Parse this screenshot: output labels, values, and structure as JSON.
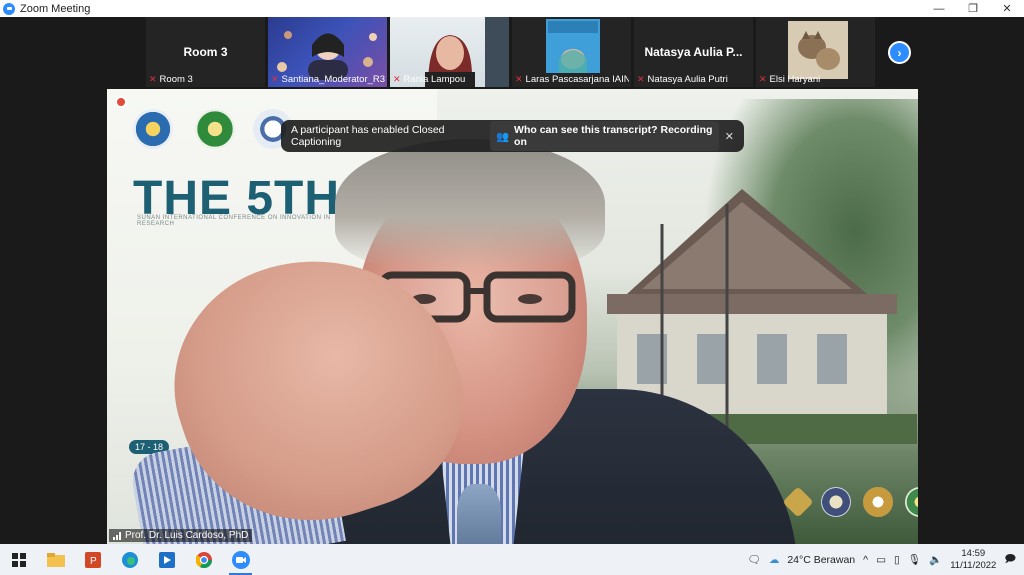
{
  "window": {
    "title": "Zoom Meeting",
    "minimize": "—",
    "restore": "❐",
    "close": "✕"
  },
  "strip": {
    "tiles": [
      {
        "big_name": "Room 3",
        "caption": "Room 3",
        "type": "name"
      },
      {
        "big_name": "",
        "caption": "Santiana_Moderator_R3",
        "type": "video"
      },
      {
        "big_name": "",
        "caption": "Rania Lampou",
        "type": "video"
      },
      {
        "big_name": "",
        "caption": "Laras Pascasarjana IAIN ...",
        "type": "video"
      },
      {
        "big_name": "Natasya Aulia P...",
        "caption": "Natasya Aulia Putri",
        "type": "name"
      },
      {
        "big_name": "",
        "caption": "Elsi Haryani",
        "type": "video"
      }
    ],
    "next_icon": "›"
  },
  "speaker": {
    "name": "Prof. Dr. Luis Cardoso, PhD",
    "event_title": "THE 5TH",
    "event_sub": "SUNAN INTERNATIONAL CONFERENCE ON INNOVATION IN RESEARCH",
    "event_date": "17 - 18"
  },
  "cc_banner": {
    "message": "A participant has enabled Closed Captioning",
    "link": "Who can see this transcript? Recording on",
    "close": "✕"
  },
  "taskbar": {
    "weather": "24°C  Berawan",
    "time": "14:59",
    "date": "11/11/2022"
  },
  "colors": {
    "accent": "#2d8cff",
    "mic_muted": "#e0303a",
    "event_teal": "#1d5f73"
  }
}
